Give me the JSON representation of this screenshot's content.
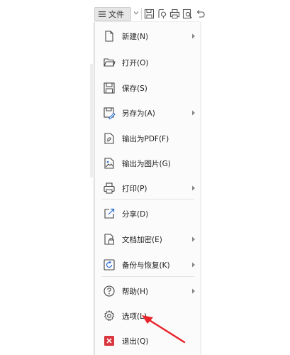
{
  "toolbar": {
    "file_label": "文件"
  },
  "menu": {
    "items": [
      {
        "label": "新建(N)",
        "icon": "new-file-icon",
        "submenu": true
      },
      {
        "label": "打开(O)",
        "icon": "open-folder-icon",
        "submenu": false
      },
      {
        "label": "保存(S)",
        "icon": "save-icon",
        "submenu": false
      },
      {
        "label": "另存为(A)",
        "icon": "save-as-icon",
        "submenu": true
      },
      {
        "label": "输出为PDF(F)",
        "icon": "export-pdf-icon",
        "submenu": false
      },
      {
        "label": "输出为图片(G)",
        "icon": "export-image-icon",
        "submenu": false
      },
      {
        "label": "打印(P)",
        "icon": "print-icon",
        "submenu": true
      },
      {
        "label": "分享(D)",
        "icon": "share-icon",
        "submenu": false
      },
      {
        "label": "文档加密(E)",
        "icon": "encrypt-icon",
        "submenu": true
      },
      {
        "label": "备份与恢复(K)",
        "icon": "backup-icon",
        "submenu": true
      },
      {
        "label": "帮助(H)",
        "icon": "help-icon",
        "submenu": true
      },
      {
        "label": "选项(L)",
        "icon": "gear-icon",
        "submenu": false
      },
      {
        "label": "退出(Q)",
        "icon": "exit-icon",
        "submenu": false
      }
    ]
  },
  "colors": {
    "annotation_arrow": "#e8232a",
    "exit_icon": "#d9363e"
  }
}
